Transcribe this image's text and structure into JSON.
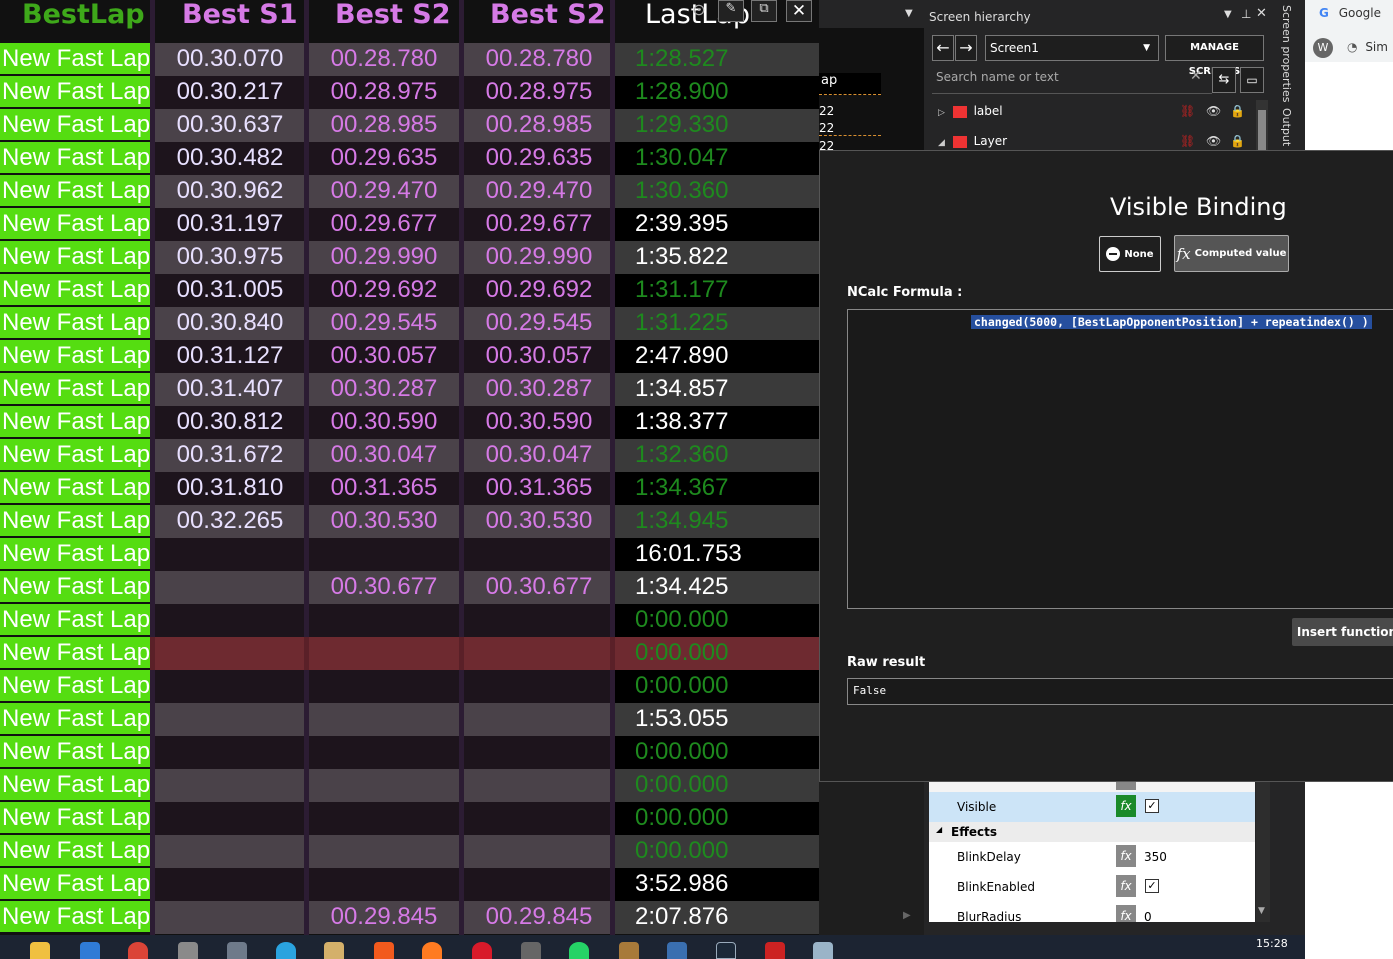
{
  "board": {
    "headers": {
      "bestlap": "BestLap",
      "s1": "Best S1",
      "s2": "Best S2",
      "s3": "Best S2",
      "last": "LastLap"
    },
    "rows": [
      {
        "label": "New Fast Lap",
        "s1": "00.30.070",
        "s2": "00.28.780",
        "s3": "00.28.780",
        "last": "1:28.527",
        "last_color": "#1e8a1e"
      },
      {
        "label": "New Fast Lap",
        "s1": "00.30.217",
        "s2": "00.28.975",
        "s3": "00.28.975",
        "last": "1:28.900",
        "last_color": "#1e8a1e"
      },
      {
        "label": "New Fast Lap",
        "s1": "00.30.637",
        "s2": "00.28.985",
        "s3": "00.28.985",
        "last": "1:29.330",
        "last_color": "#1e8a1e"
      },
      {
        "label": "New Fast Lap",
        "s1": "00.30.482",
        "s2": "00.29.635",
        "s3": "00.29.635",
        "last": "1:30.047",
        "last_color": "#1e8a1e"
      },
      {
        "label": "New Fast Lap",
        "s1": "00.30.962",
        "s2": "00.29.470",
        "s3": "00.29.470",
        "last": "1:30.360",
        "last_color": "#1e8a1e"
      },
      {
        "label": "New Fast Lap",
        "s1": "00.31.197",
        "s2": "00.29.677",
        "s3": "00.29.677",
        "last": "2:39.395",
        "last_color": "#ffffff"
      },
      {
        "label": "New Fast Lap",
        "s1": "00.30.975",
        "s2": "00.29.990",
        "s3": "00.29.990",
        "last": "1:35.822",
        "last_color": "#ffffff"
      },
      {
        "label": "New Fast Lap",
        "s1": "00.31.005",
        "s2": "00.29.692",
        "s3": "00.29.692",
        "last": "1:31.177",
        "last_color": "#1e8a1e"
      },
      {
        "label": "New Fast Lap",
        "s1": "00.30.840",
        "s2": "00.29.545",
        "s3": "00.29.545",
        "last": "1:31.225",
        "last_color": "#1e8a1e"
      },
      {
        "label": "New Fast Lap",
        "s1": "00.31.127",
        "s2": "00.30.057",
        "s3": "00.30.057",
        "last": "2:47.890",
        "last_color": "#ffffff"
      },
      {
        "label": "New Fast Lap",
        "s1": "00.31.407",
        "s2": "00.30.287",
        "s3": "00.30.287",
        "last": "1:34.857",
        "last_color": "#ffffff"
      },
      {
        "label": "New Fast Lap",
        "s1": "00.30.812",
        "s2": "00.30.590",
        "s3": "00.30.590",
        "last": "1:38.377",
        "last_color": "#ffffff"
      },
      {
        "label": "New Fast Lap",
        "s1": "00.31.672",
        "s2": "00.30.047",
        "s3": "00.30.047",
        "last": "1:32.360",
        "last_color": "#1e8a1e"
      },
      {
        "label": "New Fast Lap",
        "s1": "00.31.810",
        "s2": "00.31.365",
        "s3": "00.31.365",
        "last": "1:34.367",
        "last_color": "#1e8a1e"
      },
      {
        "label": "New Fast Lap",
        "s1": "00.32.265",
        "s2": "00.30.530",
        "s3": "00.30.530",
        "last": "1:34.945",
        "last_color": "#1e8a1e"
      },
      {
        "label": "New Fast Lap",
        "s1": "",
        "s2": "",
        "s3": "",
        "last": "16:01.753",
        "last_color": "#ffffff"
      },
      {
        "label": "New Fast Lap",
        "s1": "",
        "s2": "00.30.677",
        "s3": "00.30.677",
        "last": "1:34.425",
        "last_color": "#ffffff"
      },
      {
        "label": "New Fast Lap",
        "s1": "",
        "s2": "",
        "s3": "",
        "last": "0:00.000",
        "last_color": "#1e8a1e"
      },
      {
        "label": "New Fast Lap",
        "s1": "",
        "s2": "",
        "s3": "",
        "last": "0:00.000",
        "last_color": "#1e8a1e",
        "highlight": true
      },
      {
        "label": "New Fast Lap",
        "s1": "",
        "s2": "",
        "s3": "",
        "last": "0:00.000",
        "last_color": "#1e8a1e"
      },
      {
        "label": "New Fast Lap",
        "s1": "",
        "s2": "",
        "s3": "",
        "last": "1:53.055",
        "last_color": "#ffffff"
      },
      {
        "label": "New Fast Lap",
        "s1": "",
        "s2": "",
        "s3": "",
        "last": "0:00.000",
        "last_color": "#1e8a1e"
      },
      {
        "label": "New Fast Lap",
        "s1": "",
        "s2": "",
        "s3": "",
        "last": "0:00.000",
        "last_color": "#1e8a1e"
      },
      {
        "label": "New Fast Lap",
        "s1": "",
        "s2": "",
        "s3": "",
        "last": "0:00.000",
        "last_color": "#1e8a1e"
      },
      {
        "label": "New Fast Lap",
        "s1": "",
        "s2": "",
        "s3": "",
        "last": "0:00.000",
        "last_color": "#1e8a1e"
      },
      {
        "label": "New Fast Lap",
        "s1": "",
        "s2": "",
        "s3": "",
        "last": "3:52.986",
        "last_color": "#ffffff"
      },
      {
        "label": "New Fast Lap",
        "s1": "",
        "s2": "00.29.845",
        "s3": "00.29.845",
        "last": "2:07.876",
        "last_color": "#ffffff"
      }
    ]
  },
  "hierarchy": {
    "title": "Screen hierarchy",
    "screen_select": "Screen1",
    "manage_screens": "MANAGE SCREENS",
    "search_placeholder": "Search name or text",
    "items": [
      {
        "label": "label"
      },
      {
        "label": "Layer"
      }
    ],
    "vertical_tabs": [
      "Screen properties",
      "Output"
    ]
  },
  "canvas_fragments": [
    "ap",
    "22",
    "22",
    "22"
  ],
  "dialog": {
    "title": "Visible Binding",
    "none_label": "None",
    "computed_label": "Computed value",
    "formula_label": "NCalc Formula :",
    "formula": "changed(5000, [BestLapOpponentPosition] + repeatindex() )",
    "insert_function": "Insert function",
    "raw_result_label": "Raw result",
    "raw_result": "False"
  },
  "properties": {
    "visible_label": "Visible",
    "effects_header": "Effects",
    "rows": [
      {
        "name": "BlinkDelay",
        "value": "350"
      },
      {
        "name": "BlinkEnabled",
        "value": ""
      },
      {
        "name": "BlurRadius",
        "value": "0"
      }
    ]
  },
  "browser": {
    "tab1": "Google",
    "tab2": "Sim"
  },
  "taskbar": {
    "time": "15:28"
  },
  "colors": {
    "accent_green": "#55dd11",
    "purple_text": "#d67ae6",
    "selection_blue": "#264f9e"
  }
}
